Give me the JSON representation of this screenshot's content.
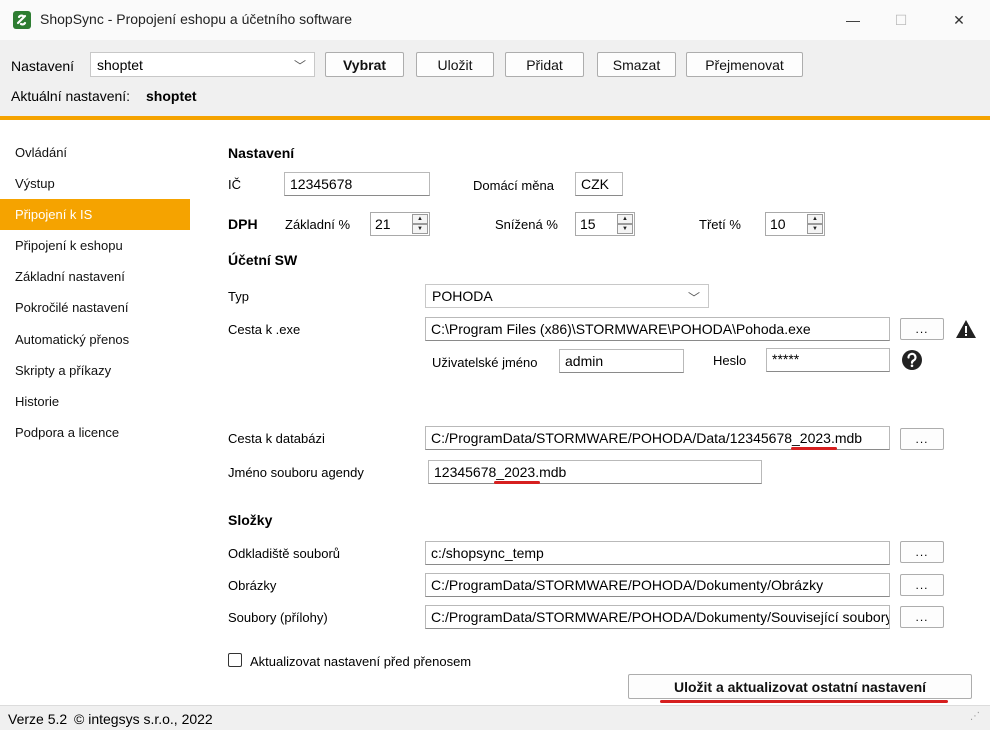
{
  "window": {
    "title": "ShopSync - Propojení eshopu a účetního software",
    "minimize": "—",
    "maximize": "☐",
    "close": "✕"
  },
  "toolbar": {
    "settings_label": "Nastavení",
    "settings_value": "shoptet",
    "buttons": {
      "select": "Vybrat",
      "save": "Uložit",
      "add": "Přidat",
      "delete": "Smazat",
      "rename": "Přejmenovat"
    },
    "current_label": "Aktuální nastavení:",
    "current_value": "shoptet"
  },
  "sidebar": {
    "items": [
      {
        "label": "Ovládání"
      },
      {
        "label": "Výstup"
      },
      {
        "label": "Připojení k IS"
      },
      {
        "label": "Připojení k eshopu"
      },
      {
        "label": "Základní nastavení"
      },
      {
        "label": "Pokročilé nastavení"
      },
      {
        "label": "Automatický přenos"
      },
      {
        "label": "Skripty a příkazy"
      },
      {
        "label": "Historie"
      },
      {
        "label": "Podpora a licence"
      }
    ],
    "active_index": 2
  },
  "settings": {
    "section_title": "Nastavení",
    "ic_label": "IČ",
    "ic_value": "12345678",
    "currency_label": "Domácí měna",
    "currency_value": "CZK",
    "dph_label": "DPH",
    "base_label": "Základní %",
    "base_value": "21",
    "reduced_label": "Snížená %",
    "reduced_value": "15",
    "third_label": "Třetí %",
    "third_value": "10"
  },
  "accounting": {
    "section_title": "Účetní SW",
    "type_label": "Typ",
    "type_value": "POHODA",
    "exe_label": "Cesta k .exe",
    "exe_value": "C:\\Program Files (x86)\\STORMWARE\\POHODA\\Pohoda.exe",
    "browse": "...",
    "user_label": "Uživatelské jméno",
    "user_value": "admin",
    "password_label": "Heslo",
    "password_value": "*****",
    "db_label": "Cesta k databázi",
    "db_value": "C:/ProgramData/STORMWARE/POHODA/Data/12345678_2023.mdb",
    "agenda_label": "Jméno souboru agendy",
    "agenda_value": "12345678_2023.mdb"
  },
  "folders": {
    "section_title": "Složky",
    "temp_label": "Odkladiště souborů",
    "temp_value": "c:/shopsync_temp",
    "images_label": "Obrázky",
    "images_value": "C:/ProgramData/STORMWARE/POHODA/Dokumenty/Obrázky",
    "files_label": "Soubory (přílohy)",
    "files_value": "C:/ProgramData/STORMWARE/POHODA/Dokumenty/Související soubory"
  },
  "update_checkbox_label": "Aktualizovat nastavení před přenosem",
  "save_update_button": "Uložit a aktualizovat ostatní nastavení",
  "status": {
    "version": "Verze 5.2",
    "copyright": "© integsys s.r.o., 2022"
  },
  "colors": {
    "accent": "#f5a300",
    "annotation_red": "#d61f1f"
  }
}
